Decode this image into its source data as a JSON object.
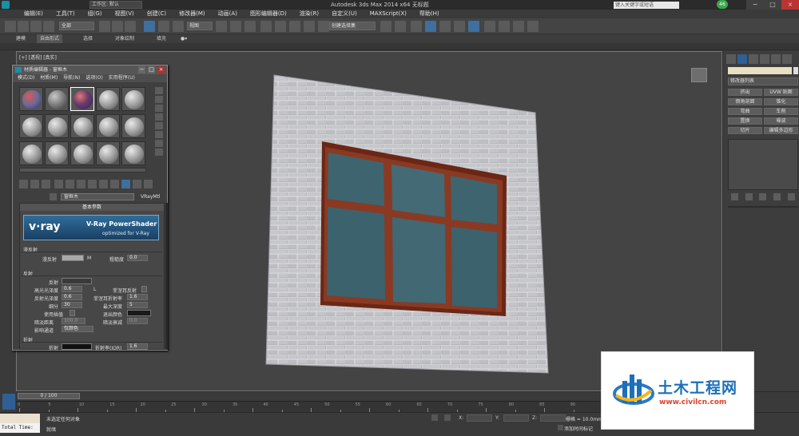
{
  "titlebar": {
    "workspace": "工作区: 默认",
    "title": "Autodesk 3ds Max  2014 x64    无标题",
    "search_placeholder": "键入关键字或短语",
    "badge": "46"
  },
  "menu": [
    "编辑(E)",
    "工具(T)",
    "组(G)",
    "视图(V)",
    "创建(C)",
    "修改器(M)",
    "动画(A)",
    "图形编辑器(D)",
    "渲染(R)",
    "自定义(U)",
    "MAXScript(X)",
    "帮助(H)"
  ],
  "toolbar": {
    "selection_filter": "全部",
    "reference_coord": "视图",
    "named_selection": "创建选择集"
  },
  "ribbon": {
    "tabs": [
      "建模",
      "自由形式",
      "选择",
      "对象绘制",
      "填充"
    ]
  },
  "viewport": {
    "label": "[+] [透视] [真实]"
  },
  "command_panel": {
    "modifier_list": "修改器列表",
    "buttons": [
      "挤出",
      "UVW 贴图",
      "倒角剖面",
      "锥化",
      "弯曲",
      "车削",
      "置换",
      "噪波",
      "切片",
      "编辑多边形"
    ]
  },
  "material_editor": {
    "title": "材质编辑器 - 窗框木",
    "menu": [
      "模式(D)",
      "材质(M)",
      "导航(N)",
      "选项(O)",
      "实用程序(U)"
    ],
    "material_name": "窗框木",
    "material_type": "VRayMtl",
    "rollout_title": "基本参数",
    "vray_logo": "v·ray",
    "vray_title": "V-Ray PowerShader",
    "vray_subtitle": "optimized for V-Ray",
    "diffuse_group": "漫反射",
    "diffuse_label": "漫反射",
    "diffuse_map_btn": "M",
    "roughness_label": "粗糙度",
    "roughness_value": "0.0",
    "reflect_group": "反射",
    "reflect_label": "反射",
    "hilight_gloss_label": "高光光泽度",
    "hilight_gloss_value": "0.6",
    "lock_btn": "L",
    "fresnel_label": "菲涅耳反射",
    "refl_gloss_label": "反射光泽度",
    "refl_gloss_value": "0.6",
    "fresnel_ior_label": "菲涅耳折射率",
    "fresnel_ior_value": "1.6",
    "subdivs_label": "细分",
    "subdivs_value": "30",
    "max_depth_label": "最大深度",
    "max_depth_value": "5",
    "use_interp_label": "使用插值",
    "exit_color_label": "退出颜色",
    "dim_distance_label": "暗淡距离",
    "dim_distance_value": "100.0",
    "dim_falloff_label": "暗淡衰减",
    "dim_falloff_value": "0.0",
    "affect_channels_label": "影响通道",
    "affect_channels_value": "仅颜色",
    "refract_group": "折射",
    "refract_label": "折射",
    "refract_ior_label": "折射率(IOR)",
    "refract_ior_value": "1.6"
  },
  "timeline": {
    "slider": "0 / 100",
    "ticks": [
      "0",
      "5",
      "10",
      "15",
      "20",
      "25",
      "30",
      "35",
      "40",
      "45",
      "50",
      "55",
      "60",
      "65",
      "70",
      "75",
      "80",
      "85",
      "90"
    ]
  },
  "status": {
    "listener": "Total Time:",
    "line1": "未选定任何对象",
    "line2": "就绪",
    "x_label": "X:",
    "y_label": "Y:",
    "z_label": "Z:",
    "grid": "栅格 = 10.0mm",
    "add_time_tag": "添加时间标记"
  },
  "watermark": {
    "text": "土木工程网",
    "url": "www.civilcn.com"
  },
  "colors": {
    "accent": "#3f6f9e",
    "window_frame": "#7a2e1a",
    "glass": "#3f6570",
    "brick": "#b9b9bd"
  }
}
